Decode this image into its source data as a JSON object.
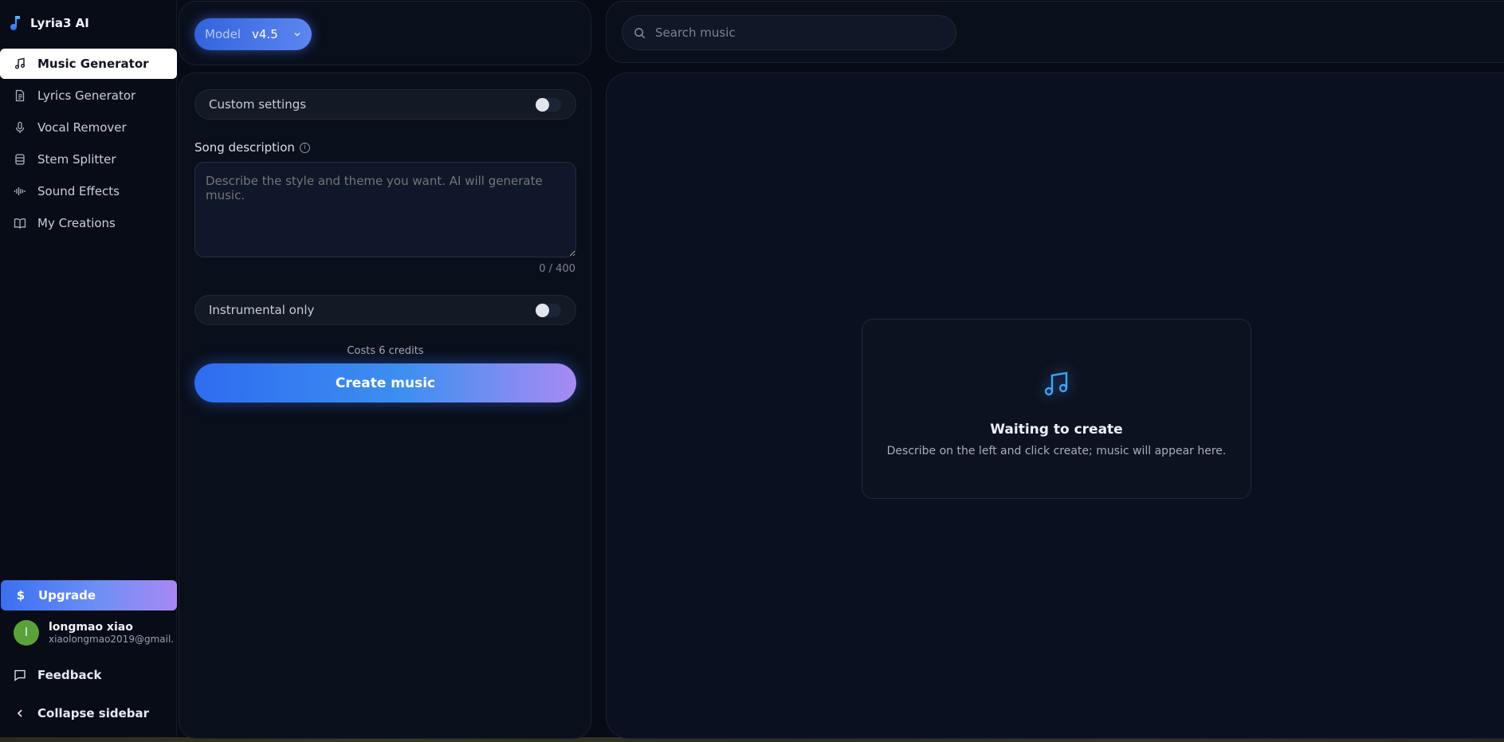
{
  "app": {
    "name": "Lyria3 AI"
  },
  "sidebar": {
    "items": [
      {
        "label": "Music Generator",
        "icon": "music-note-icon",
        "active": true
      },
      {
        "label": "Lyrics Generator",
        "icon": "document-icon",
        "active": false
      },
      {
        "label": "Vocal Remover",
        "icon": "microphone-icon",
        "active": false
      },
      {
        "label": "Stem Splitter",
        "icon": "stem-split-icon",
        "active": false
      },
      {
        "label": "Sound Effects",
        "icon": "waveform-icon",
        "active": false
      },
      {
        "label": "My Creations",
        "icon": "book-icon",
        "active": false
      }
    ],
    "upgrade_label": "Upgrade",
    "upgrade_icon": "$",
    "user": {
      "initial": "l",
      "name": "longmao xiao",
      "email": "xiaolongmao2019@gmail."
    },
    "feedback_label": "Feedback",
    "collapse_label": "Collapse sidebar"
  },
  "model": {
    "label": "Model",
    "value": "v4.5"
  },
  "form": {
    "custom_settings_label": "Custom settings",
    "custom_settings_on": false,
    "song_description_label": "Song description",
    "info_glyph": "i",
    "description_placeholder": "Describe the style and theme you want. AI will generate music.",
    "description_value": "",
    "char_count": "0 / 400",
    "instrumental_label": "Instrumental only",
    "instrumental_on": false,
    "credits_text": "Costs 6 credits",
    "create_label": "Create music"
  },
  "search": {
    "placeholder": "Search music"
  },
  "output": {
    "empty_title": "Waiting to create",
    "empty_subtitle": "Describe on the left and click create; music will appear here."
  },
  "colors": {
    "background": "#070b15",
    "accent_blue": "#2e6cf0",
    "accent_purple": "#a88af3",
    "icon_cyan": "#3aa7ff",
    "avatar_green": "#5aa13a"
  }
}
